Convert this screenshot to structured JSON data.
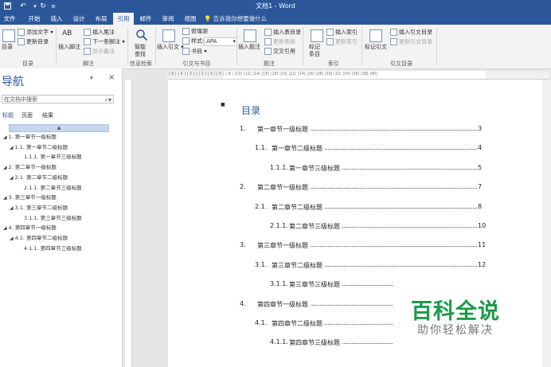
{
  "titlebar": {
    "title": "文档1 - Word",
    "save_icon": "save-icon",
    "undo_icon": "undo-icon",
    "redo_icon": "redo-icon"
  },
  "tabs": [
    {
      "label": "文件"
    },
    {
      "label": "开始"
    },
    {
      "label": "插入"
    },
    {
      "label": "设计"
    },
    {
      "label": "布局"
    },
    {
      "label": "引用",
      "active": true
    },
    {
      "label": "邮件"
    },
    {
      "label": "审阅"
    },
    {
      "label": "视图"
    }
  ],
  "tell_me": "告诉我你想要做什么",
  "ribbon": {
    "toc": {
      "label": "目录",
      "add_text": "添加文字",
      "update_toc": "更新目录",
      "group": "目录"
    },
    "footnote": {
      "insert_footnote": "插入脚注",
      "insert_endnote": "插入尾注",
      "next_footnote": "下一条脚注",
      "show_notes": "显示备注",
      "group": "脚注",
      "ab_glyph": "AB"
    },
    "research": {
      "smart_lookup_1": "智能",
      "smart_lookup_2": "查找",
      "group": "信息检索"
    },
    "citations": {
      "insert_citation": "插入引文",
      "manage_sources": "管理源",
      "style_label": "样式:",
      "style_value": "APA",
      "bibliography": "书目",
      "group": "引文与书目"
    },
    "captions": {
      "insert_caption": "插入题注",
      "insert_table_of_figures": "插入表目录",
      "update_table": "更新表格",
      "cross_reference": "交叉引用",
      "group": "题注"
    },
    "index": {
      "mark_entry_1": "标记",
      "mark_entry_2": "条目",
      "insert_index": "插入索引",
      "update_index": "更新索引",
      "group": "索引"
    },
    "authorities": {
      "mark_citation": "标记引文",
      "insert_toa": "插入引文目录",
      "update_toa": "更新引文目录",
      "group": "引文目录"
    }
  },
  "nav": {
    "title": "导航",
    "search_placeholder": "在文档中搜索",
    "tabs": [
      "标题",
      "页面",
      "结果"
    ],
    "items": [
      {
        "label": "1. 第一章节一级标题",
        "level": 1
      },
      {
        "label": "1.1. 第一章节二级标题",
        "level": 2
      },
      {
        "label": "1.1.1. 第一章节三级标题",
        "level": 3
      },
      {
        "label": "2. 第二章节一级标题",
        "level": 1
      },
      {
        "label": "2.1. 第二章节二级标题",
        "level": 2
      },
      {
        "label": "2.1.1. 第二章节三级标题",
        "level": 3
      },
      {
        "label": "3. 第三章节一级标题",
        "level": 1
      },
      {
        "label": "3.1. 第三章节二级标题",
        "level": 2
      },
      {
        "label": "3.1.1. 第三章节三级标题",
        "level": 3
      },
      {
        "label": "4. 第四章节一级标题",
        "level": 1
      },
      {
        "label": "4.1. 第四章节二级标题",
        "level": 2
      },
      {
        "label": "4.1.1. 第四章节三级标题",
        "level": 3
      }
    ]
  },
  "ruler": {
    "marks": "| 6 |   | 4 |   | 2 |   |   | 2 |   | 4 |   | 6 |   | 8 |   |10|   |12|   |14|   |16|   |18|   |20|   |22|   |24|   |26|   |28|   |30|   |32|   |34|   |36|   |38|   |40|"
  },
  "document": {
    "toc_title": "目录",
    "entries": [
      {
        "num": "1.",
        "text": "第一章节一级标题",
        "page": "3",
        "level": 1
      },
      {
        "num": "1.1.",
        "text": "第一章节二级标题",
        "page": "4",
        "level": 2
      },
      {
        "num": "1.1.1.",
        "text": "第一章节三级标题",
        "page": "5",
        "level": 3
      },
      {
        "num": "2.",
        "text": "第二章节一级标题",
        "page": "7",
        "level": 1
      },
      {
        "num": "2.1.",
        "text": "第二章节二级标题",
        "page": "8",
        "level": 2
      },
      {
        "num": "2.1.1.",
        "text": "第二章节三级标题",
        "page": "10",
        "level": 3
      },
      {
        "num": "3.",
        "text": "第三章节一级标题",
        "page": "11",
        "level": 1
      },
      {
        "num": "3.1.",
        "text": "第三章节二级标题",
        "page": "12",
        "level": 2
      },
      {
        "num": "3.1.1.",
        "text": "第三章节三级标题",
        "page": "",
        "level": 3
      },
      {
        "num": "4.",
        "text": "第四章节一级标题",
        "page": "",
        "level": 1
      },
      {
        "num": "4.1.",
        "text": "第四章节二级标题",
        "page": "",
        "level": 2
      },
      {
        "num": "4.1.1.",
        "text": "第四章节三级标题",
        "page": "",
        "level": 3
      }
    ]
  },
  "watermark": {
    "main": "百科全说",
    "sub": "助你轻松解决"
  },
  "colors": {
    "accent": "#2b579a",
    "watermark": "#1a9b48"
  }
}
